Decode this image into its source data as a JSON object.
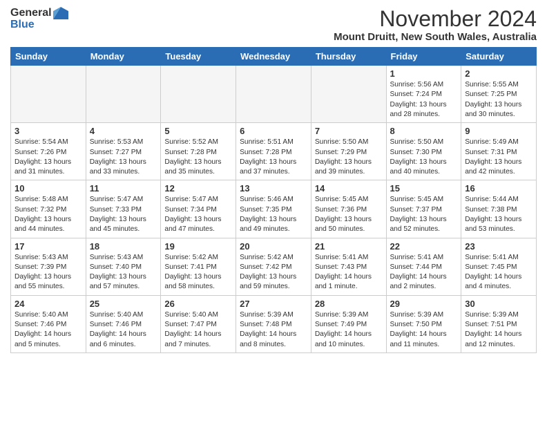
{
  "header": {
    "logo_general": "General",
    "logo_blue": "Blue",
    "title": "November 2024",
    "location": "Mount Druitt, New South Wales, Australia"
  },
  "columns": [
    "Sunday",
    "Monday",
    "Tuesday",
    "Wednesday",
    "Thursday",
    "Friday",
    "Saturday"
  ],
  "weeks": [
    [
      {
        "day": "",
        "detail": ""
      },
      {
        "day": "",
        "detail": ""
      },
      {
        "day": "",
        "detail": ""
      },
      {
        "day": "",
        "detail": ""
      },
      {
        "day": "",
        "detail": ""
      },
      {
        "day": "1",
        "detail": "Sunrise: 5:56 AM\nSunset: 7:24 PM\nDaylight: 13 hours\nand 28 minutes."
      },
      {
        "day": "2",
        "detail": "Sunrise: 5:55 AM\nSunset: 7:25 PM\nDaylight: 13 hours\nand 30 minutes."
      }
    ],
    [
      {
        "day": "3",
        "detail": "Sunrise: 5:54 AM\nSunset: 7:26 PM\nDaylight: 13 hours\nand 31 minutes."
      },
      {
        "day": "4",
        "detail": "Sunrise: 5:53 AM\nSunset: 7:27 PM\nDaylight: 13 hours\nand 33 minutes."
      },
      {
        "day": "5",
        "detail": "Sunrise: 5:52 AM\nSunset: 7:28 PM\nDaylight: 13 hours\nand 35 minutes."
      },
      {
        "day": "6",
        "detail": "Sunrise: 5:51 AM\nSunset: 7:28 PM\nDaylight: 13 hours\nand 37 minutes."
      },
      {
        "day": "7",
        "detail": "Sunrise: 5:50 AM\nSunset: 7:29 PM\nDaylight: 13 hours\nand 39 minutes."
      },
      {
        "day": "8",
        "detail": "Sunrise: 5:50 AM\nSunset: 7:30 PM\nDaylight: 13 hours\nand 40 minutes."
      },
      {
        "day": "9",
        "detail": "Sunrise: 5:49 AM\nSunset: 7:31 PM\nDaylight: 13 hours\nand 42 minutes."
      }
    ],
    [
      {
        "day": "10",
        "detail": "Sunrise: 5:48 AM\nSunset: 7:32 PM\nDaylight: 13 hours\nand 44 minutes."
      },
      {
        "day": "11",
        "detail": "Sunrise: 5:47 AM\nSunset: 7:33 PM\nDaylight: 13 hours\nand 45 minutes."
      },
      {
        "day": "12",
        "detail": "Sunrise: 5:47 AM\nSunset: 7:34 PM\nDaylight: 13 hours\nand 47 minutes."
      },
      {
        "day": "13",
        "detail": "Sunrise: 5:46 AM\nSunset: 7:35 PM\nDaylight: 13 hours\nand 49 minutes."
      },
      {
        "day": "14",
        "detail": "Sunrise: 5:45 AM\nSunset: 7:36 PM\nDaylight: 13 hours\nand 50 minutes."
      },
      {
        "day": "15",
        "detail": "Sunrise: 5:45 AM\nSunset: 7:37 PM\nDaylight: 13 hours\nand 52 minutes."
      },
      {
        "day": "16",
        "detail": "Sunrise: 5:44 AM\nSunset: 7:38 PM\nDaylight: 13 hours\nand 53 minutes."
      }
    ],
    [
      {
        "day": "17",
        "detail": "Sunrise: 5:43 AM\nSunset: 7:39 PM\nDaylight: 13 hours\nand 55 minutes."
      },
      {
        "day": "18",
        "detail": "Sunrise: 5:43 AM\nSunset: 7:40 PM\nDaylight: 13 hours\nand 57 minutes."
      },
      {
        "day": "19",
        "detail": "Sunrise: 5:42 AM\nSunset: 7:41 PM\nDaylight: 13 hours\nand 58 minutes."
      },
      {
        "day": "20",
        "detail": "Sunrise: 5:42 AM\nSunset: 7:42 PM\nDaylight: 13 hours\nand 59 minutes."
      },
      {
        "day": "21",
        "detail": "Sunrise: 5:41 AM\nSunset: 7:43 PM\nDaylight: 14 hours\nand 1 minute."
      },
      {
        "day": "22",
        "detail": "Sunrise: 5:41 AM\nSunset: 7:44 PM\nDaylight: 14 hours\nand 2 minutes."
      },
      {
        "day": "23",
        "detail": "Sunrise: 5:41 AM\nSunset: 7:45 PM\nDaylight: 14 hours\nand 4 minutes."
      }
    ],
    [
      {
        "day": "24",
        "detail": "Sunrise: 5:40 AM\nSunset: 7:46 PM\nDaylight: 14 hours\nand 5 minutes."
      },
      {
        "day": "25",
        "detail": "Sunrise: 5:40 AM\nSunset: 7:46 PM\nDaylight: 14 hours\nand 6 minutes."
      },
      {
        "day": "26",
        "detail": "Sunrise: 5:40 AM\nSunset: 7:47 PM\nDaylight: 14 hours\nand 7 minutes."
      },
      {
        "day": "27",
        "detail": "Sunrise: 5:39 AM\nSunset: 7:48 PM\nDaylight: 14 hours\nand 8 minutes."
      },
      {
        "day": "28",
        "detail": "Sunrise: 5:39 AM\nSunset: 7:49 PM\nDaylight: 14 hours\nand 10 minutes."
      },
      {
        "day": "29",
        "detail": "Sunrise: 5:39 AM\nSunset: 7:50 PM\nDaylight: 14 hours\nand 11 minutes."
      },
      {
        "day": "30",
        "detail": "Sunrise: 5:39 AM\nSunset: 7:51 PM\nDaylight: 14 hours\nand 12 minutes."
      }
    ]
  ]
}
